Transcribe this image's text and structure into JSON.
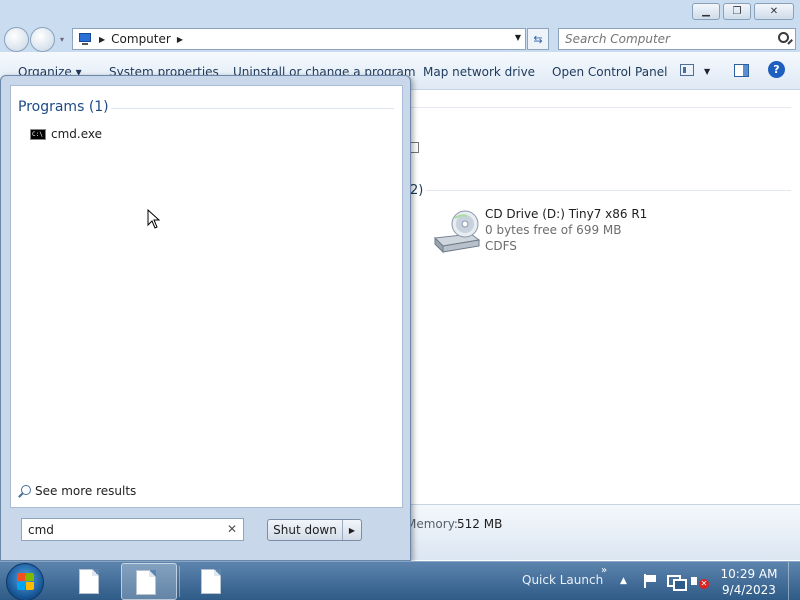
{
  "window": {
    "address": {
      "location": "Computer"
    },
    "search": {
      "placeholder": "Search Computer"
    },
    "toolbar": {
      "organize": "Organize ▾",
      "system_properties": "System properties",
      "uninstall": "Uninstall or change a program",
      "map_network": "Map network drive",
      "control_panel": "Open Control Panel"
    },
    "content": {
      "group_count": "2)",
      "drive": {
        "name": "CD Drive (D:) Tiny7 x86 R1",
        "free": "0 bytes free of 699 MB",
        "filesystem": "CDFS"
      }
    },
    "details": {
      "memory_label": "Memory:",
      "memory_value": "512 MB"
    }
  },
  "start_menu": {
    "programs_header": "Programs (1)",
    "results": [
      {
        "label": "cmd.exe",
        "icon": "console-icon"
      }
    ],
    "see_more": "See more results",
    "search_value": "cmd",
    "shutdown_label": "Shut down"
  },
  "taskbar": {
    "quick_launch": "Quick Launch",
    "time": "10:29 AM",
    "date": "9/4/2023"
  },
  "colors": {
    "taskbar": "#2f5b88",
    "start_menu_frame": "#c8d8ea",
    "accent_text": "#1e4a86"
  }
}
